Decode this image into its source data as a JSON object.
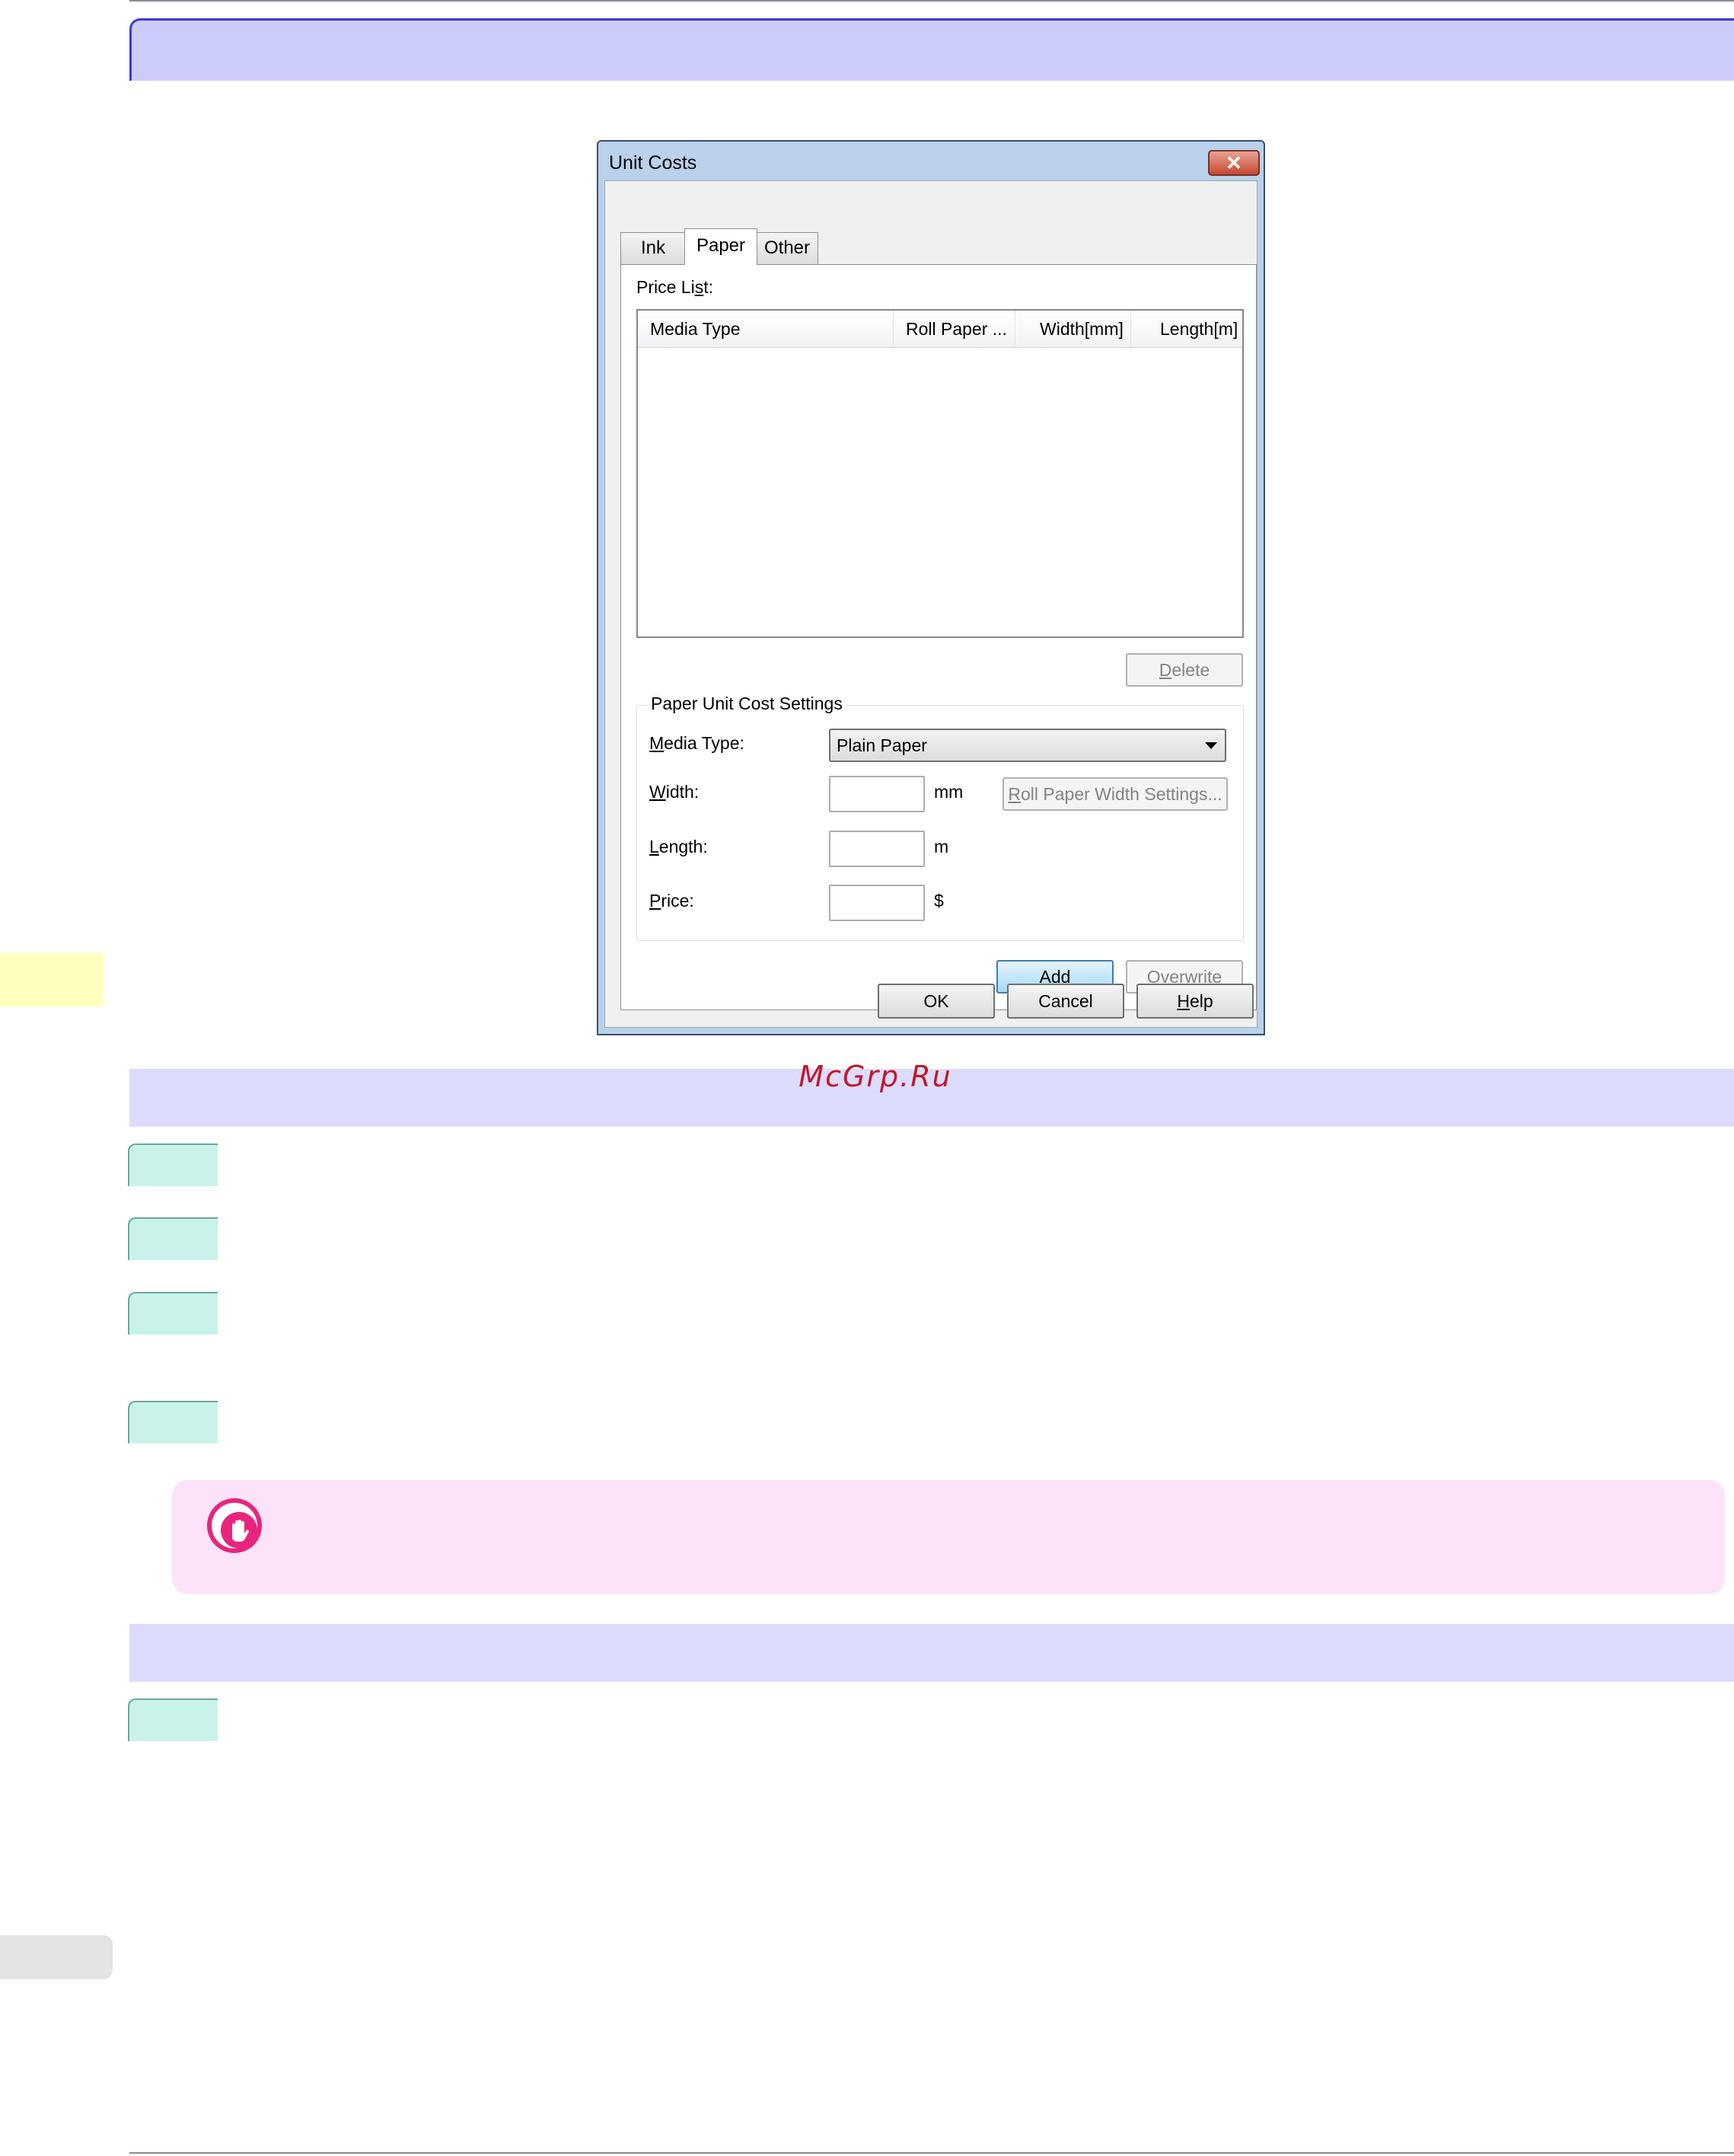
{
  "watermark": "McGrp.Ru",
  "dialog": {
    "title": "Unit Costs",
    "close_glyph": "✕",
    "tabs": [
      {
        "label": "Ink"
      },
      {
        "label": "Paper"
      },
      {
        "label": "Other"
      }
    ],
    "active_tab": "Paper",
    "price_list_label_pre": "Price Li",
    "price_list_label_mn": "s",
    "price_list_label_post": "t:",
    "list_columns": [
      "Media Type",
      "Roll Paper ...",
      "Width[mm]",
      "Length[m]"
    ],
    "list_rows": [],
    "delete_mn": "D",
    "delete_rest": "elete",
    "group_title": "Paper Unit Cost Settings",
    "media_type_mn": "M",
    "media_type_rest": "edia Type:",
    "media_type_value": "Plain Paper",
    "width_mn": "W",
    "width_rest": "idth:",
    "width_value": "",
    "width_unit": "mm",
    "roll_width_mn": "R",
    "roll_width_rest": "oll Paper Width Settings...",
    "length_mn": "L",
    "length_rest": "ength:",
    "length_value": "",
    "length_unit": "m",
    "price_mn": "P",
    "price_rest": "rice:",
    "price_value": "",
    "price_unit": "$",
    "add_mn": "A",
    "add_rest": "dd",
    "overwrite_mn": "O",
    "overwrite_rest": "verwrite",
    "ok_label": "OK",
    "cancel_label": "Cancel",
    "help_mn": "H",
    "help_rest": "elp"
  },
  "colors": {
    "title_band": "#ccccfc",
    "section_band": "#dcdcfc",
    "step_tab": "#c8f2ea",
    "note_background": "#fde3fa",
    "note_icon": "#e8247e",
    "side_marker": "#ffffbe",
    "watermark": "#c0182a"
  },
  "icons": {
    "note": "important-hand-icon",
    "close": "close-icon",
    "dropdown": "chevron-down-icon"
  }
}
